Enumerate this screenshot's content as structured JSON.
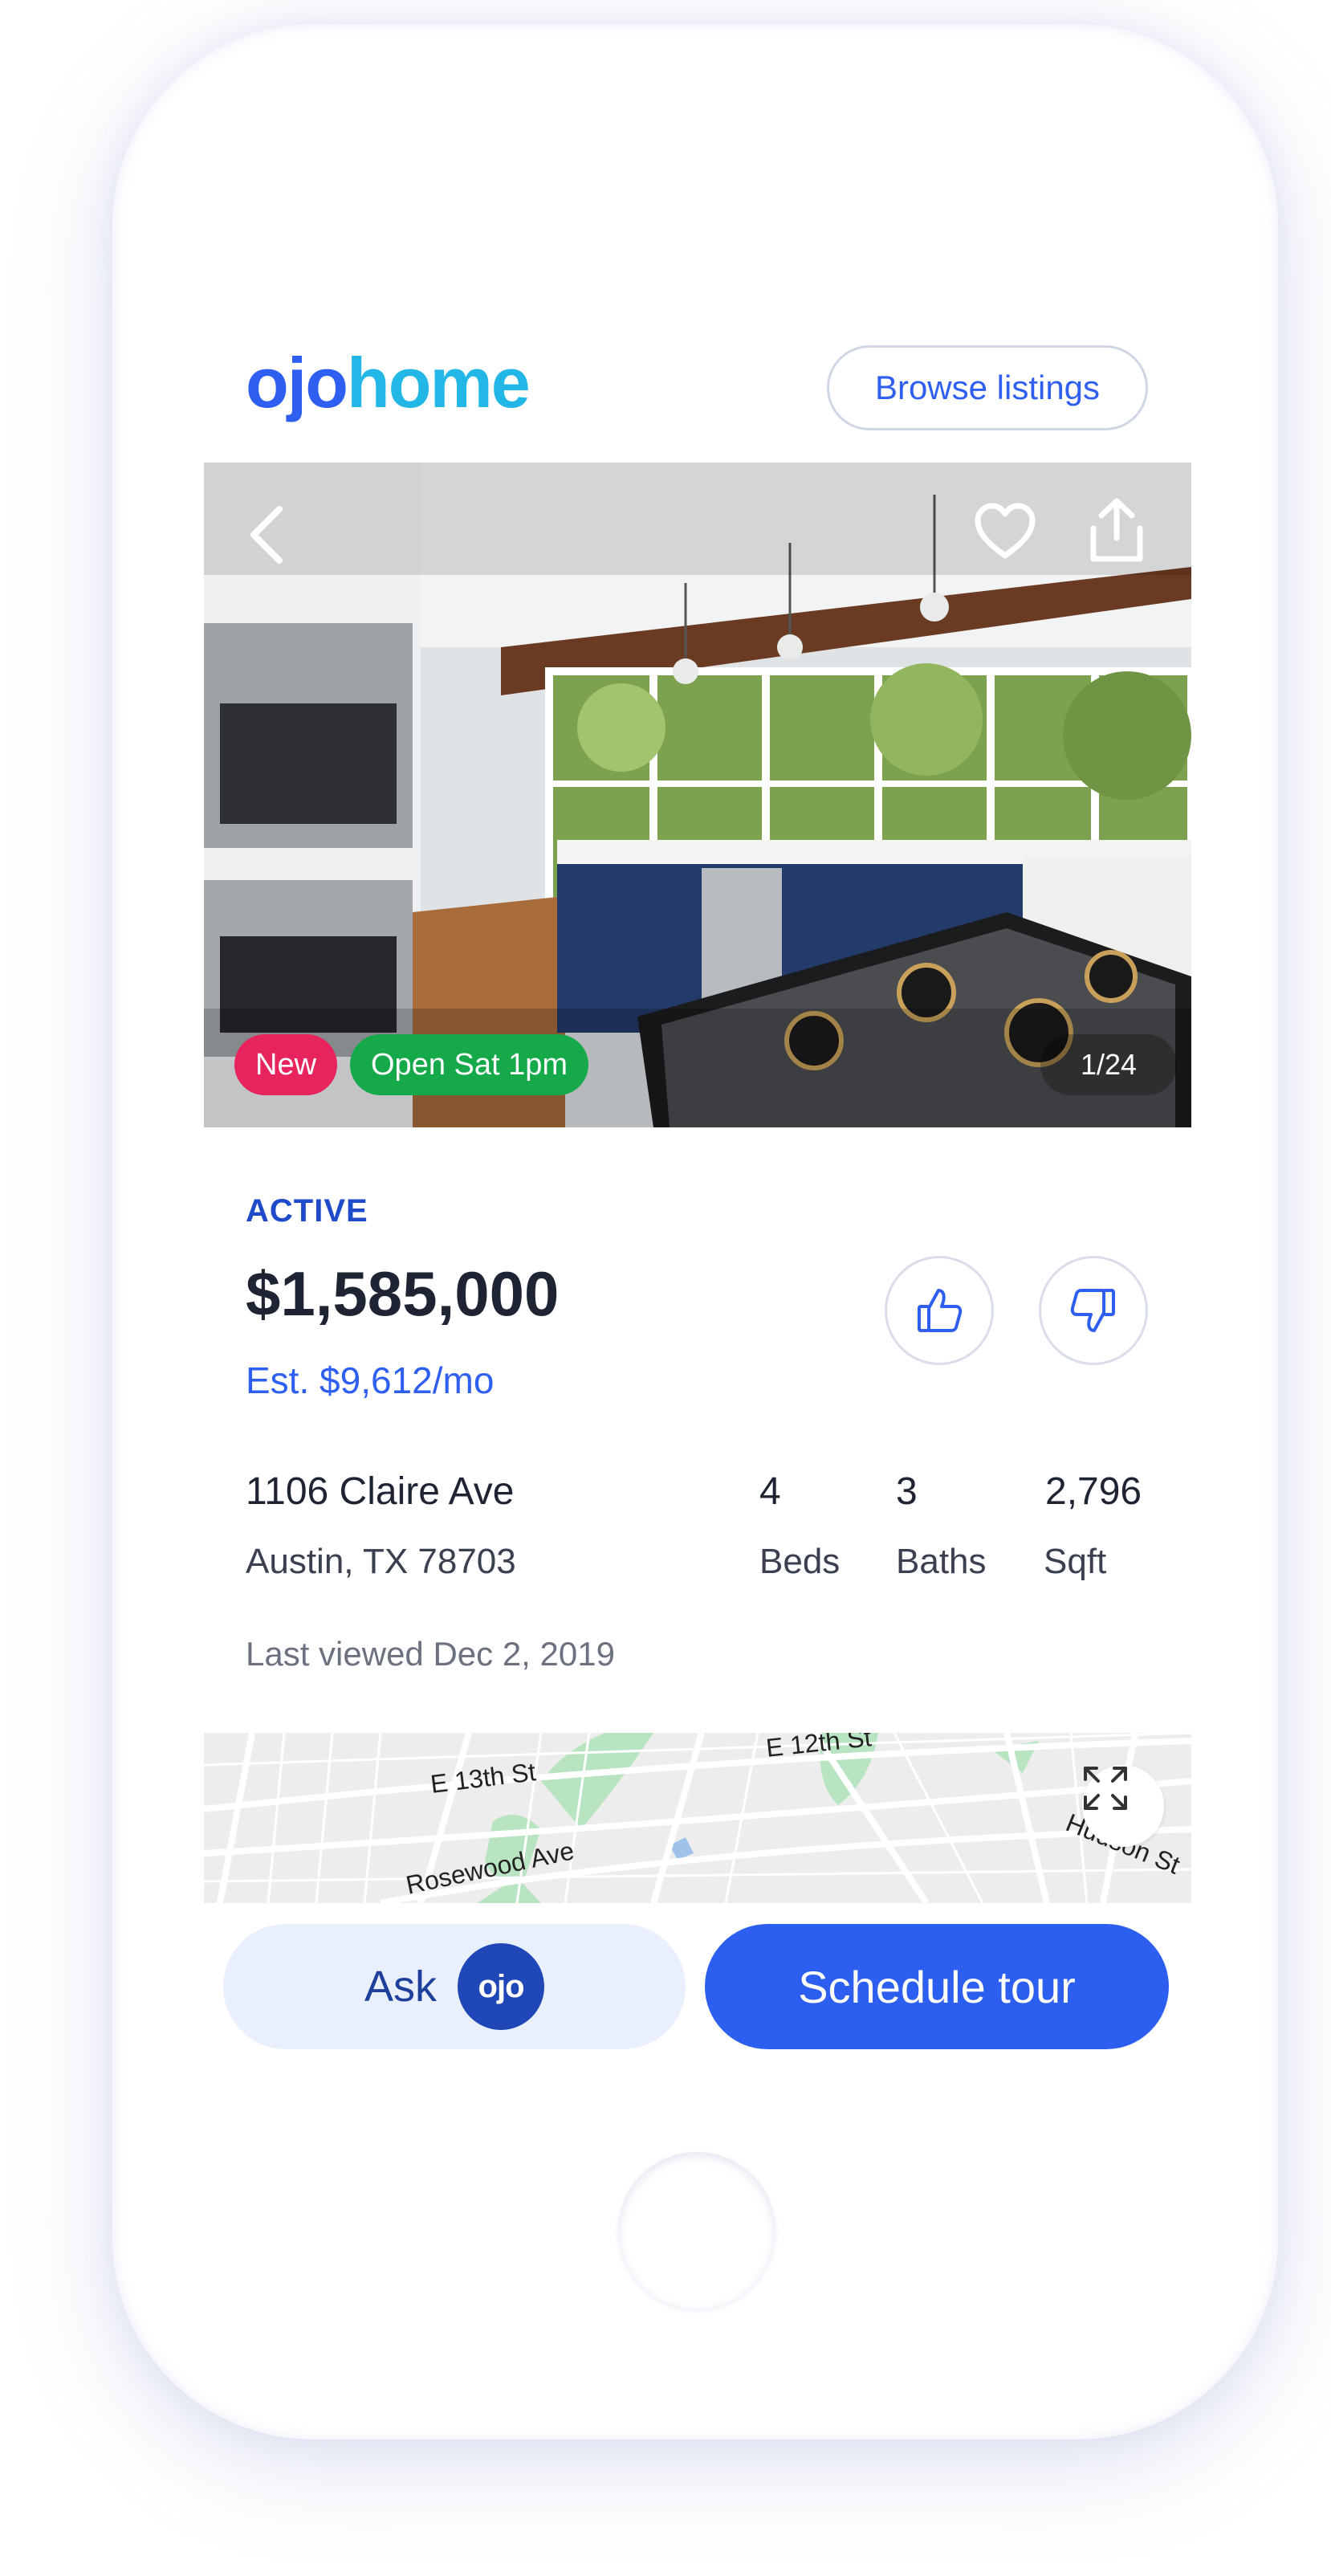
{
  "header": {
    "logo_part1": "ojo",
    "logo_part2": "home",
    "browse_label": "Browse listings"
  },
  "photo": {
    "badge_new": "New",
    "badge_open": "Open Sat 1pm",
    "counter": "1/24",
    "icons": [
      "back-icon",
      "heart-icon",
      "share-icon"
    ]
  },
  "listing": {
    "status": "ACTIVE",
    "price": "$1,585,000",
    "estimate": "Est. $9,612/mo",
    "address_line1": "1106 Claire Ave",
    "address_line2": "Austin, TX 78703",
    "beds_value": "4",
    "beds_label": "Beds",
    "baths_value": "3",
    "baths_label": "Baths",
    "sqft_value": "2,796",
    "sqft_label": "Sqft",
    "last_viewed": "Last viewed Dec 2, 2019"
  },
  "map": {
    "streets": [
      "E 13th St",
      "E 12th St",
      "Rosewood Ave",
      "Hudson St"
    ]
  },
  "actions": {
    "ask_label": "Ask",
    "ask_badge": "ojo",
    "tour_label": "Schedule tour"
  },
  "colors": {
    "brand_blue": "#2f5ff0",
    "brand_cyan": "#22b7e6",
    "new_badge": "#e8245e",
    "open_badge": "#15a94a",
    "status_blue": "#1f4ac9"
  }
}
